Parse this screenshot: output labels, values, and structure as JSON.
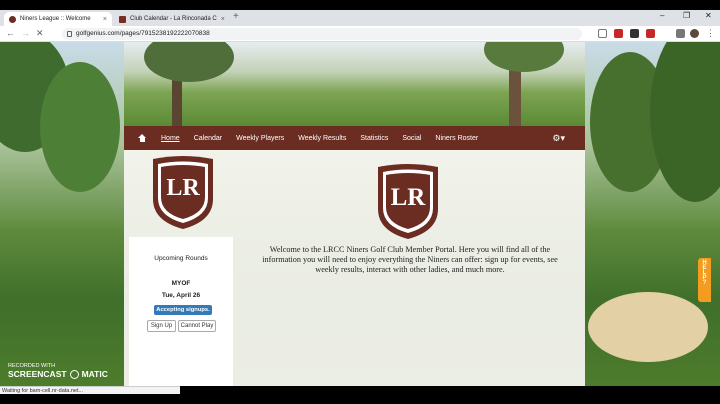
{
  "browser": {
    "tabs": [
      {
        "label": "Niners League :: Welcome",
        "close": "×"
      },
      {
        "label": "Club Calendar - La Rinconada C",
        "close": "×"
      }
    ],
    "new_tab": "+",
    "url": "golfgenius.com/pages/7915238192222070838",
    "window_controls": [
      "–",
      "❐",
      "✕"
    ]
  },
  "site": {
    "menu": [
      "Home",
      "Calendar",
      "Weekly Players",
      "Weekly Results",
      "Statistics",
      "Social",
      "Niners Roster"
    ],
    "gear": "⚙▾",
    "logo_text": "LR",
    "welcome": "Welcome to the LRCC Niners Golf Club Member Portal.  Here you will find all of the information you will need to enjoy everything the Niners can offer:  sign up for events, see weekly results, interact with other ladies, and much more."
  },
  "rounds": {
    "title": "Upcoming Rounds",
    "event": "MYOF",
    "date": "Tue, April 26",
    "badge": "Accepting signups.",
    "signup": "Sign Up",
    "cannot": "Cannot Play"
  },
  "help": {
    "label": "HELP?"
  },
  "status_bar": {
    "text": "Waiting for bam-cell.nr-data.net..."
  },
  "watermark": {
    "top": "RECORDED WITH",
    "left": "SCREENCAST",
    "right": "MATIC"
  },
  "colors": {
    "menu": "#6b2c22",
    "badge": "#337ab7",
    "help": "#f39c1f"
  }
}
